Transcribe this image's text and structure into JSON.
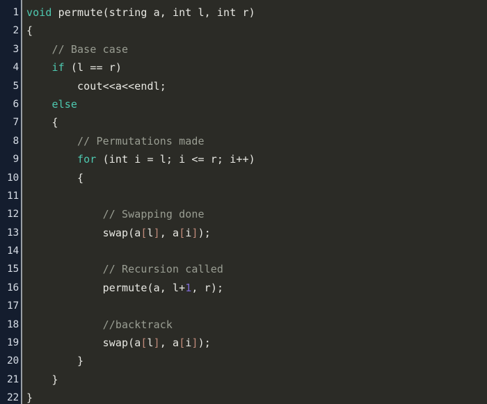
{
  "editor": {
    "title": "C++ permute function code snippet",
    "language": "cpp",
    "theme": {
      "background": "#2b2b26",
      "gutter_background": "#141d2e",
      "gutter_text": "#d7dde6",
      "gutter_separator": "#9aa0a6",
      "default_text": "#e8e8e3",
      "keyword": "#4ec9b0",
      "comment": "#9a9e93",
      "number": "#7d6ad1",
      "bracket": "#c08a7a"
    },
    "total_lines": 22
  },
  "line_numbers": [
    "1",
    "2",
    "3",
    "4",
    "5",
    "6",
    "7",
    "8",
    "9",
    "10",
    "11",
    "12",
    "13",
    "14",
    "15",
    "16",
    "17",
    "18",
    "19",
    "20",
    "21",
    "22"
  ],
  "lines": [
    {
      "number": "1",
      "indent": 0,
      "tokens": [
        {
          "t": "void",
          "c": "kw"
        },
        {
          "t": " permute(string a, int l, int r)",
          "c": "plain"
        }
      ]
    },
    {
      "number": "2",
      "indent": 0,
      "tokens": [
        {
          "t": "{",
          "c": "punct"
        }
      ]
    },
    {
      "number": "3",
      "indent": 1,
      "tokens": [
        {
          "t": "// Base case",
          "c": "comment"
        }
      ]
    },
    {
      "number": "4",
      "indent": 1,
      "tokens": [
        {
          "t": "if",
          "c": "kw"
        },
        {
          "t": " (l == r)",
          "c": "plain"
        }
      ]
    },
    {
      "number": "5",
      "indent": 2,
      "tokens": [
        {
          "t": "cout<<a<<endl;",
          "c": "plain"
        }
      ]
    },
    {
      "number": "6",
      "indent": 1,
      "tokens": [
        {
          "t": "else",
          "c": "kw"
        }
      ]
    },
    {
      "number": "7",
      "indent": 1,
      "tokens": [
        {
          "t": "{",
          "c": "punct"
        }
      ]
    },
    {
      "number": "8",
      "indent": 2,
      "tokens": [
        {
          "t": "// Permutations made",
          "c": "comment"
        }
      ]
    },
    {
      "number": "9",
      "indent": 2,
      "tokens": [
        {
          "t": "for",
          "c": "kw"
        },
        {
          "t": " (int i = l; i <= r; i++)",
          "c": "plain"
        }
      ]
    },
    {
      "number": "10",
      "indent": 2,
      "tokens": [
        {
          "t": "{",
          "c": "punct"
        }
      ]
    },
    {
      "number": "11",
      "indent": 0,
      "tokens": []
    },
    {
      "number": "12",
      "indent": 3,
      "tokens": [
        {
          "t": "// Swapping done",
          "c": "comment"
        }
      ]
    },
    {
      "number": "13",
      "indent": 3,
      "tokens": [
        {
          "t": "swap(a",
          "c": "plain"
        },
        {
          "t": "[",
          "c": "bracket"
        },
        {
          "t": "l",
          "c": "plain"
        },
        {
          "t": "]",
          "c": "bracket"
        },
        {
          "t": ", a",
          "c": "plain"
        },
        {
          "t": "[",
          "c": "bracket"
        },
        {
          "t": "i",
          "c": "plain"
        },
        {
          "t": "]",
          "c": "bracket"
        },
        {
          "t": ");",
          "c": "plain"
        }
      ]
    },
    {
      "number": "14",
      "indent": 0,
      "tokens": []
    },
    {
      "number": "15",
      "indent": 3,
      "tokens": [
        {
          "t": "// Recursion called",
          "c": "comment"
        }
      ]
    },
    {
      "number": "16",
      "indent": 3,
      "tokens": [
        {
          "t": "permute(a, l+",
          "c": "plain"
        },
        {
          "t": "1",
          "c": "number"
        },
        {
          "t": ", r);",
          "c": "plain"
        }
      ]
    },
    {
      "number": "17",
      "indent": 0,
      "tokens": []
    },
    {
      "number": "18",
      "indent": 3,
      "tokens": [
        {
          "t": "//backtrack",
          "c": "comment"
        }
      ]
    },
    {
      "number": "19",
      "indent": 3,
      "tokens": [
        {
          "t": "swap(a",
          "c": "plain"
        },
        {
          "t": "[",
          "c": "bracket"
        },
        {
          "t": "l",
          "c": "plain"
        },
        {
          "t": "]",
          "c": "bracket"
        },
        {
          "t": ", a",
          "c": "plain"
        },
        {
          "t": "[",
          "c": "bracket"
        },
        {
          "t": "i",
          "c": "plain"
        },
        {
          "t": "]",
          "c": "bracket"
        },
        {
          "t": ");",
          "c": "plain"
        }
      ]
    },
    {
      "number": "20",
      "indent": 2,
      "tokens": [
        {
          "t": "}",
          "c": "punct"
        }
      ]
    },
    {
      "number": "21",
      "indent": 1,
      "tokens": [
        {
          "t": "}",
          "c": "punct"
        }
      ]
    },
    {
      "number": "22",
      "indent": 0,
      "tokens": [
        {
          "t": "}",
          "c": "punct"
        }
      ]
    }
  ],
  "source_text": "void permute(string a, int l, int r)\n{\n    // Base case\n    if (l == r)\n        cout<<a<<endl;\n    else\n    {\n        // Permutations made\n        for (int i = l; i <= r; i++)\n        {\n\n            // Swapping done\n            swap(a[l], a[i]);\n\n            // Recursion called\n            permute(a, l+1, r);\n\n            //backtrack\n            swap(a[l], a[i]);\n        }\n    }\n}"
}
